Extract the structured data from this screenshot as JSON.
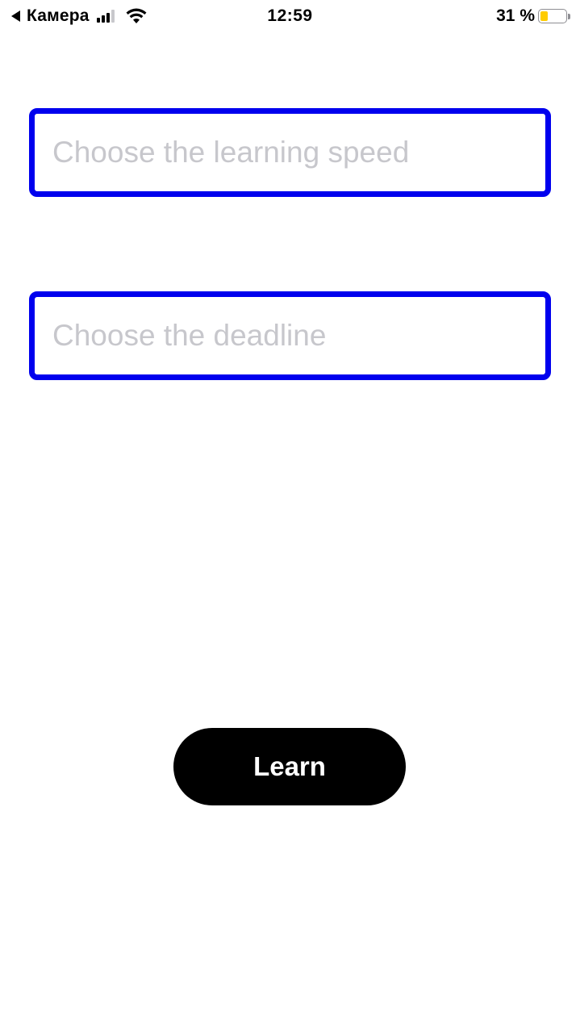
{
  "status_bar": {
    "back_app": "Камера",
    "time": "12:59",
    "battery_percent": "31 %",
    "battery_level": 0.31,
    "battery_color": "#ffcc00",
    "signal_bars_active": 3,
    "signal_bars_total": 4,
    "icons": [
      "back-arrow-icon",
      "cellular-signal-icon",
      "wifi-icon",
      "battery-icon"
    ]
  },
  "form": {
    "speed_field": {
      "value": "",
      "placeholder": "Choose the learning speed"
    },
    "deadline_field": {
      "value": "",
      "placeholder": "Choose the deadline"
    },
    "field_border_color": "#0000ee",
    "placeholder_color": "#c7c7cc"
  },
  "actions": {
    "learn_label": "Learn",
    "button_color": "#000000"
  }
}
